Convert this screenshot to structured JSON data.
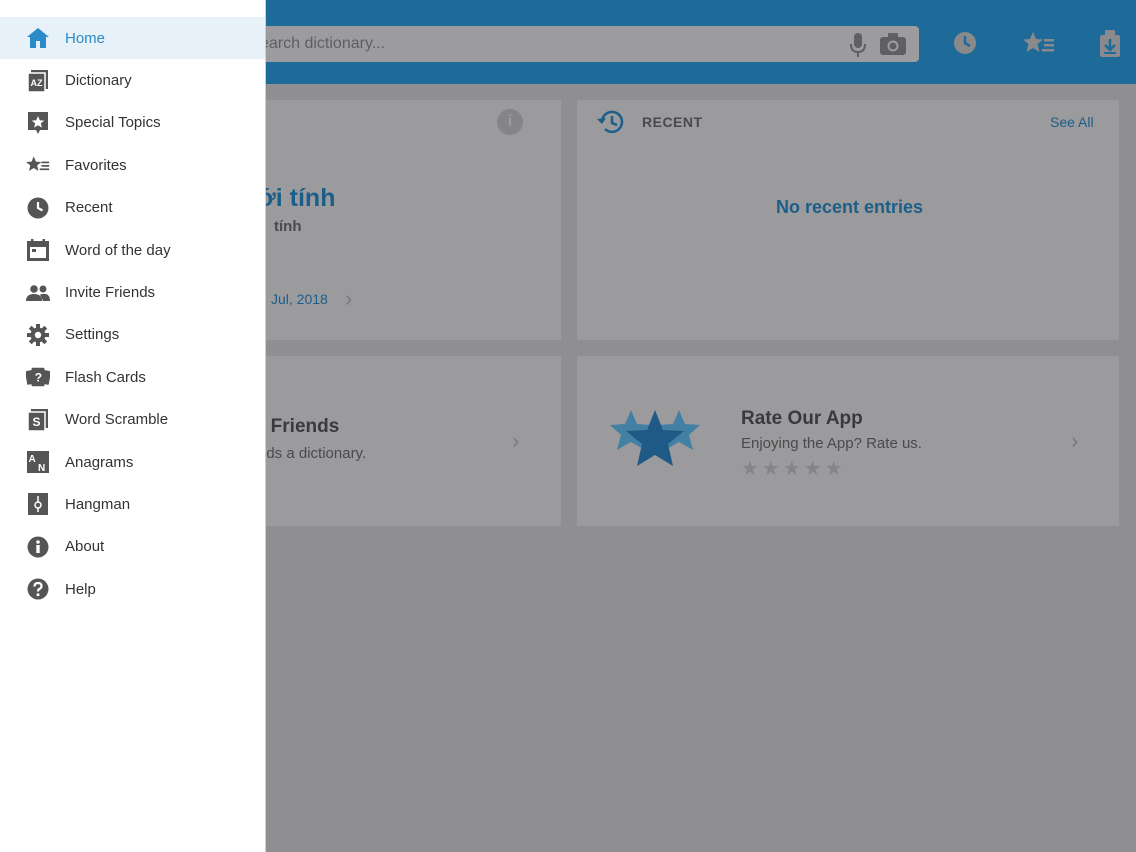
{
  "app": {
    "search_placeholder": "earch dictionary...",
    "accent_color": "#2d8ac8"
  },
  "toolbar": {
    "icons": [
      "microphone-icon",
      "camera-icon",
      "history-icon",
      "favorites-icon",
      "downloads-icon"
    ]
  },
  "word_of_day": {
    "word": "ới tính",
    "translation": "tính",
    "date": "Jul, 2018"
  },
  "recent": {
    "title": "RECENT",
    "see_all": "See All",
    "empty_message": "No recent entries"
  },
  "invite": {
    "title": "r Friends",
    "subtitle": "eds a dictionary."
  },
  "rate": {
    "title": "Rate Our App",
    "subtitle": "Enjoying the App? Rate us.",
    "stars": "★★★★★",
    "rating_filled": 0,
    "rating_max": 5
  },
  "drawer": {
    "items": [
      {
        "label": "Home",
        "icon": "home-icon",
        "active": true
      },
      {
        "label": "Dictionary",
        "icon": "dictionary-icon"
      },
      {
        "label": "Special Topics",
        "icon": "special-topics-icon"
      },
      {
        "label": "Favorites",
        "icon": "favorites-icon"
      },
      {
        "label": "Recent",
        "icon": "clock-icon"
      },
      {
        "label": "Word of the day",
        "icon": "calendar-icon"
      },
      {
        "label": "Invite Friends",
        "icon": "people-icon"
      },
      {
        "label": "Settings",
        "icon": "gear-icon"
      },
      {
        "label": "Flash Cards",
        "icon": "flash-cards-icon"
      },
      {
        "label": "Word Scramble",
        "icon": "word-scramble-icon"
      },
      {
        "label": "Anagrams",
        "icon": "anagrams-icon"
      },
      {
        "label": "Hangman",
        "icon": "hangman-icon"
      },
      {
        "label": "About",
        "icon": "info-icon"
      },
      {
        "label": "Help",
        "icon": "help-icon"
      }
    ]
  }
}
